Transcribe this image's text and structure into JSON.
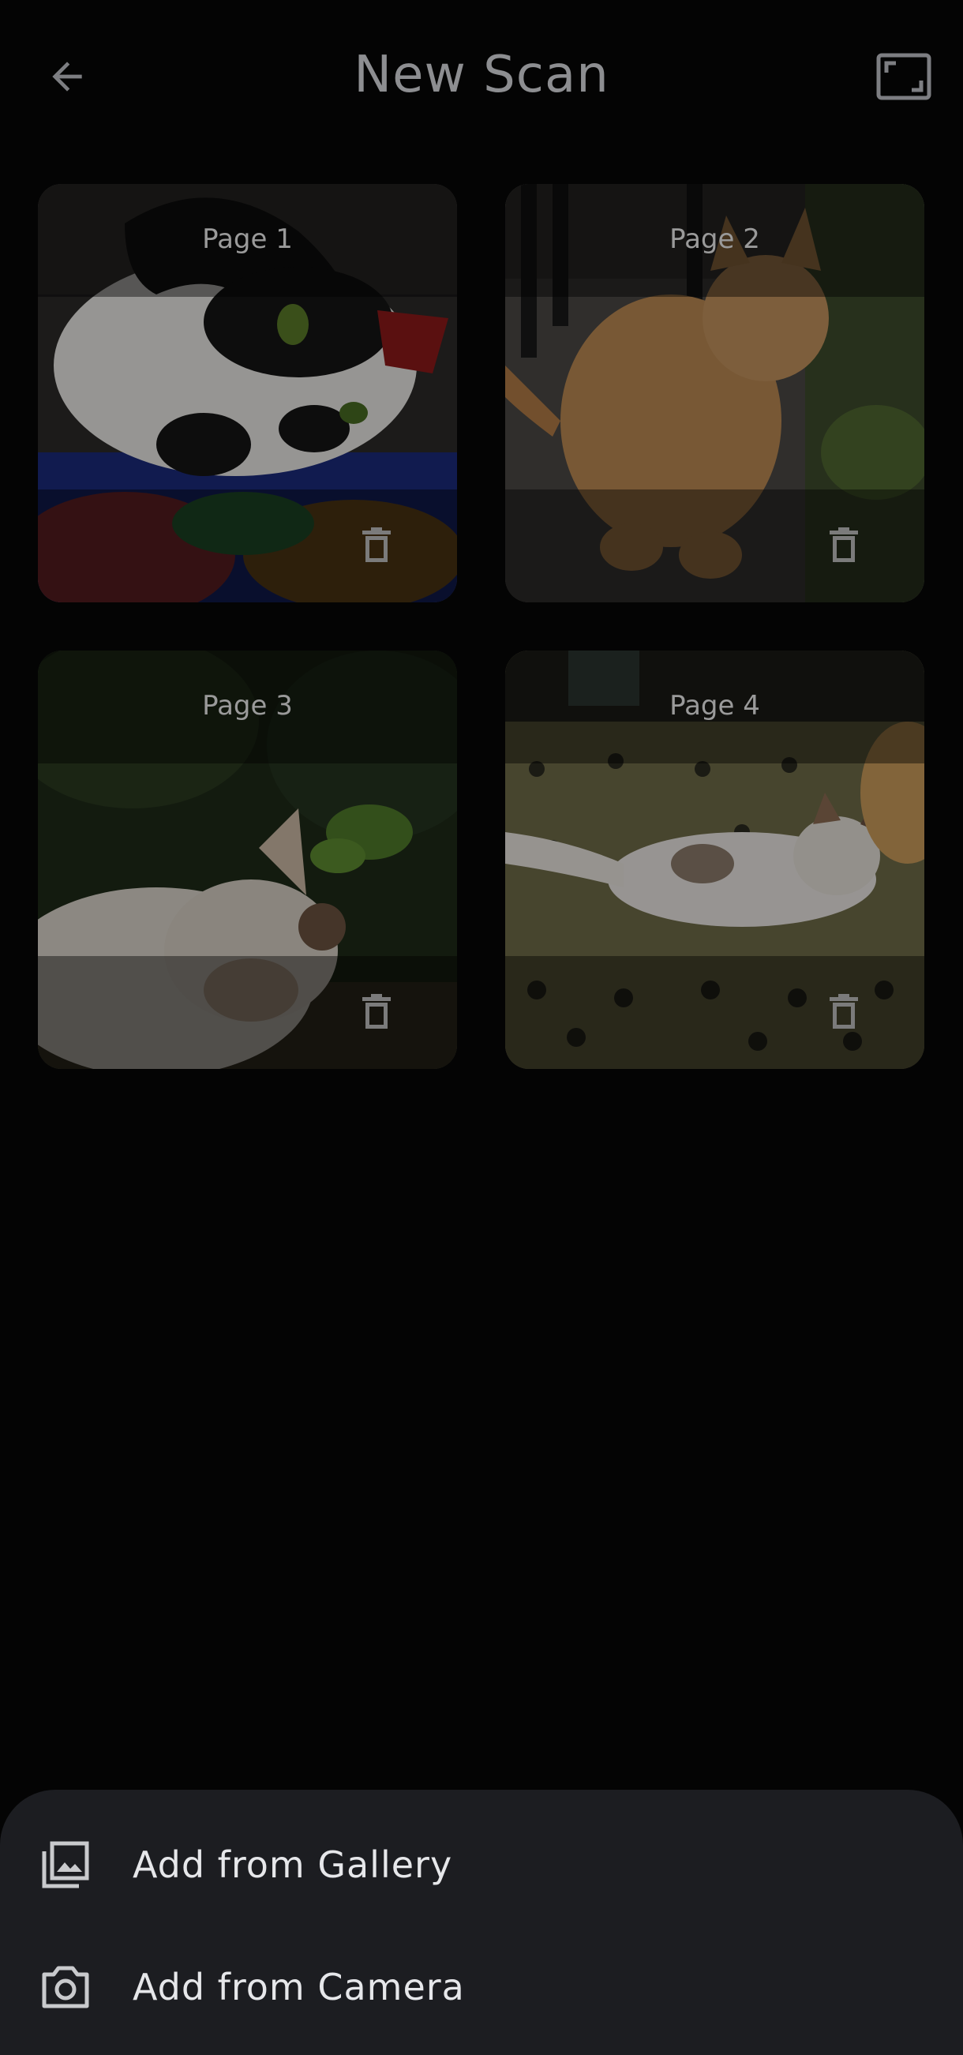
{
  "app_bar": {
    "title": "New Scan",
    "back_icon": "arrow-back-icon",
    "crop_icon": "crop-free-icon"
  },
  "pages": [
    {
      "label": "Page 1",
      "subject": "black-and-white cat lying on colorful blanket"
    },
    {
      "label": "Page 2",
      "subject": "orange tabby cat sitting"
    },
    {
      "label": "Page 3",
      "subject": "white cat sleeping in grass"
    },
    {
      "label": "Page 4",
      "subject": "calico cat lying on patterned rug"
    }
  ],
  "delete_icon": "trash-icon",
  "sheet": {
    "gallery_label": "Add from Gallery",
    "camera_label": "Add from Camera",
    "gallery_icon": "photo-library-icon",
    "camera_icon": "camera-icon"
  },
  "colors": {
    "background": "#040404",
    "sheet": "#1c1d21",
    "sheet_text": "#e6e7ea",
    "dim_text": "#8d8e91"
  }
}
